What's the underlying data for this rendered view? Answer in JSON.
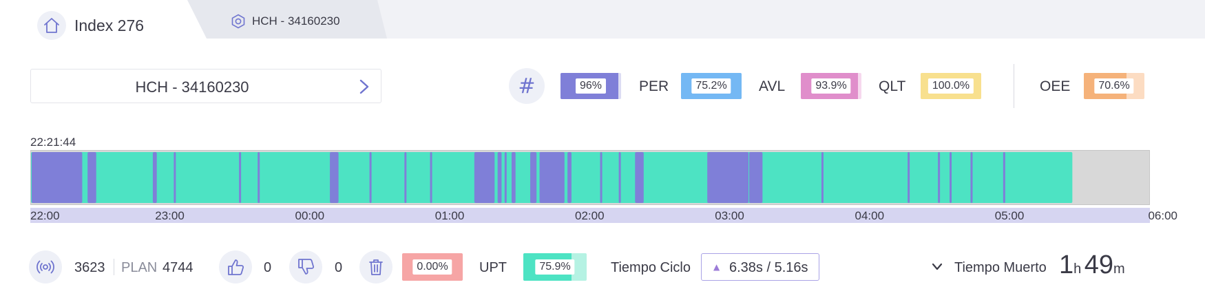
{
  "tabs": {
    "home": {
      "label": "Index 276",
      "icon": "home-icon"
    },
    "machine": {
      "label": "HCH - 34160230",
      "icon": "hexagon-icon"
    }
  },
  "machine_selector": {
    "label": "HCH - 34160230",
    "icon": "chevron-right-icon"
  },
  "kpis": {
    "count_icon": "#",
    "count": {
      "value": "96%",
      "fraction": 0.96,
      "color": "#7f7fd8"
    },
    "per": {
      "label": "PER",
      "value": "75.2%",
      "fraction": 1.0,
      "color": "#74b8f4"
    },
    "avl": {
      "label": "AVL",
      "value": "93.9%",
      "fraction": 0.939,
      "color": "#e08ecb"
    },
    "qlt": {
      "label": "QLT",
      "value": "100.0%",
      "fraction": 1.0,
      "color": "#f8e08e"
    },
    "oee": {
      "label": "OEE",
      "value": "70.6%",
      "fraction": 0.706,
      "color": "#f5b27a"
    }
  },
  "timeline": {
    "start_time": "22:21:44",
    "colors": {
      "run": "#4de3c3",
      "stop": "#7f7fd8",
      "future": "#d8d8d8"
    },
    "axis_ticks": [
      "22:00",
      "23:00",
      "00:00",
      "01:00",
      "02:00",
      "03:00",
      "04:00",
      "05:00",
      "06:00"
    ],
    "stops": [
      [
        "22:00",
        "22:22"
      ],
      [
        "22:24",
        "22:28"
      ],
      [
        "22:52",
        "22:54"
      ],
      [
        "23:01",
        "23:02"
      ],
      [
        "23:29",
        "23:30"
      ],
      [
        "23:37",
        "23:38"
      ],
      [
        "00:08",
        "00:12"
      ],
      [
        "00:25",
        "00:26"
      ],
      [
        "00:40",
        "00:41"
      ],
      [
        "00:51",
        "00:52"
      ],
      [
        "01:10",
        "01:19"
      ],
      [
        "01:20",
        "01:22"
      ],
      [
        "01:23",
        "01:24"
      ],
      [
        "01:26",
        "01:28"
      ],
      [
        "01:34",
        "01:37"
      ],
      [
        "01:38",
        "01:49"
      ],
      [
        "01:50",
        "01:52"
      ],
      [
        "02:04",
        "02:05"
      ],
      [
        "02:12",
        "02:13"
      ],
      [
        "02:19",
        "02:23"
      ],
      [
        "02:50",
        "03:08"
      ],
      [
        "03:08",
        "03:14"
      ],
      [
        "03:39",
        "03:40"
      ],
      [
        "04:16",
        "04:17"
      ],
      [
        "04:29",
        "04:30"
      ],
      [
        "04:34",
        "04:35"
      ],
      [
        "04:43",
        "04:44"
      ],
      [
        "04:57",
        "04:58"
      ]
    ],
    "now": "05:27"
  },
  "production": {
    "count": "3623",
    "plan_label": "PLAN",
    "plan": "4744",
    "likes": "0",
    "dislikes": "0",
    "scrap_pct": {
      "value": "0.00%",
      "fraction": 0.0,
      "color": "#f6a5a5"
    },
    "upt": {
      "label": "UPT",
      "value": "75.9%",
      "fraction": 0.759,
      "color": "#4de3c3"
    },
    "cycle": {
      "label": "Tiempo Ciclo",
      "value": "6.38s / 5.16s"
    },
    "dead_time": {
      "label": "Tiempo Muerto",
      "hours": "1",
      "hours_unit": "h",
      "minutes": "49",
      "minutes_unit": "m"
    }
  }
}
